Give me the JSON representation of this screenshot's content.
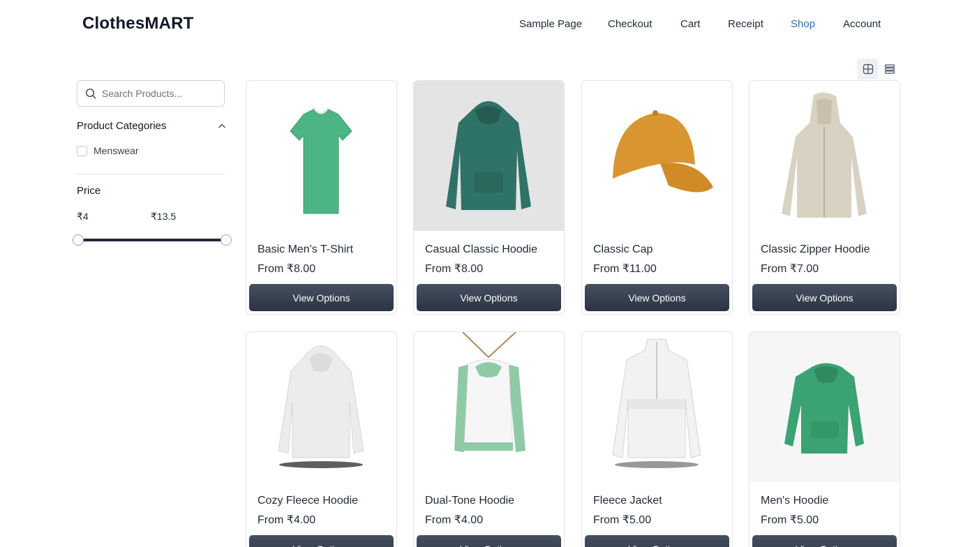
{
  "header": {
    "logo": "ClothesMART",
    "nav": [
      {
        "label": "Sample Page",
        "active": false
      },
      {
        "label": "Checkout",
        "active": false
      },
      {
        "label": "Cart",
        "active": false
      },
      {
        "label": "Receipt",
        "active": false
      },
      {
        "label": "Shop",
        "active": true
      },
      {
        "label": "Account",
        "active": false
      }
    ],
    "active_color": "#2f6fb5"
  },
  "view_toggle": {
    "selected": "grid",
    "icons": [
      "grid-icon",
      "list-icon"
    ]
  },
  "sidebar": {
    "search": {
      "placeholder": "Search Products...",
      "value": ""
    },
    "categories": {
      "title": "Product Categories",
      "expanded": true,
      "items": [
        {
          "label": "Menswear",
          "checked": false
        }
      ]
    },
    "price": {
      "title": "Price",
      "min_label": "₹4",
      "max_label": "₹13.5",
      "min": 4,
      "max": 13.5,
      "selected_min": 4,
      "selected_max": 13.5
    }
  },
  "products": [
    {
      "name": "Basic Men's T-Shirt",
      "price": "From ₹8.00",
      "button": "View Options",
      "image": "green-tshirt",
      "color": "#4cb583",
      "bg": "#ffffff"
    },
    {
      "name": "Casual Classic Hoodie",
      "price": "From ₹8.00",
      "button": "View Options",
      "image": "teal-hoodie",
      "color": "#2f7368",
      "bg": "#e4e4e4"
    },
    {
      "name": "Classic Cap",
      "price": "From ₹11.00",
      "button": "View Options",
      "image": "orange-cap",
      "color": "#d99530",
      "bg": "#ffffff"
    },
    {
      "name": "Classic Zipper Hoodie",
      "price": "From ₹7.00",
      "button": "View Options",
      "image": "beige-zip-hoodie",
      "color": "#d8d2c2",
      "bg": "#ffffff"
    },
    {
      "name": "Cozy Fleece Hoodie",
      "price": "From ₹4.00",
      "button": "View Options",
      "image": "white-hoodie",
      "color": "#eeeeee",
      "bg": "#ffffff"
    },
    {
      "name": "Dual-Tone Hoodie",
      "price": "From ₹4.00",
      "button": "View Options",
      "image": "dual-tone-hoodie",
      "color": "#8fcaa6",
      "bg": "#ffffff"
    },
    {
      "name": "Fleece Jacket",
      "price": "From ₹5.00",
      "button": "View Options",
      "image": "white-fleece-jacket",
      "color": "#f2f2f2",
      "bg": "#ffffff"
    },
    {
      "name": "Men's Hoodie",
      "price": "From ₹5.00",
      "button": "View Options",
      "image": "green-hoodie",
      "color": "#3aa273",
      "bg": "#f6f6f6"
    }
  ]
}
